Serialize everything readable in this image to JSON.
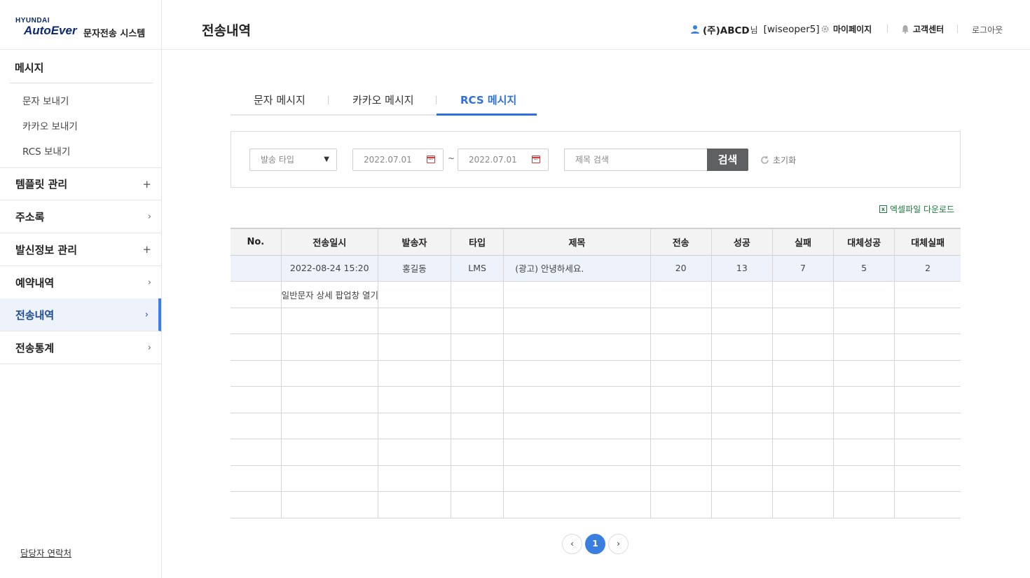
{
  "logo": {
    "brand_small": "HYUNDAI",
    "brand_big": "AutoEver",
    "system_name": "문자전송 시스템"
  },
  "sidebar": {
    "group_title": "메시지",
    "submenu": [
      "문자 보내기",
      "카카오 보내기",
      "RCS 보내기"
    ],
    "items": [
      {
        "label": "템플릿 관리",
        "indicator": "+"
      },
      {
        "label": "주소록",
        "indicator": "›"
      },
      {
        "label": "발신정보 관리",
        "indicator": "+"
      },
      {
        "label": "예약내역",
        "indicator": "›"
      },
      {
        "label": "전송내역",
        "indicator": "›",
        "active": true
      },
      {
        "label": "전송통계",
        "indicator": "›"
      }
    ],
    "contact": "담당자 연락처"
  },
  "header": {
    "page_title": "전송내역",
    "user_company": "(주)ABCD",
    "user_suffix": "님",
    "user_id": "[wiseoper5]",
    "mypage": "마이페이지",
    "support": "고객센터",
    "logout": "로그아웃"
  },
  "tabs": [
    {
      "label": "문자 메시지",
      "active": false
    },
    {
      "label": "카카오 메시지",
      "active": false
    },
    {
      "label": "RCS 메시지",
      "active": true
    }
  ],
  "search": {
    "send_type": "발송 타입",
    "date_from": "2022.07.01",
    "date_sep": "~",
    "date_to": "2022.07.01",
    "title_placeholder": "제목 검색",
    "button": "검색",
    "reset": "초기화"
  },
  "excel_download": "엑셀파일 다운로드",
  "table": {
    "headers": [
      "No.",
      "전송일시",
      "발송자",
      "타입",
      "제목",
      "전송",
      "성공",
      "실패",
      "대체성공",
      "대체실패"
    ],
    "row": {
      "no": "",
      "datetime": "2022-08-24 15:20",
      "sender": "홍길동",
      "type": "LMS",
      "title": "(광고) 안녕하세요.",
      "sent": "20",
      "success": "13",
      "fail": "7",
      "alt_success": "5",
      "alt_fail": "2"
    },
    "popup_link": "일반문자 상세 팝업창 열기"
  },
  "pagination": {
    "prev": "‹",
    "current": "1",
    "next": "›"
  },
  "colors": {
    "accent": "#2e6fdb",
    "brand": "#0b2a6e",
    "fail": "#d0232b",
    "excel": "#1f7a3f"
  }
}
